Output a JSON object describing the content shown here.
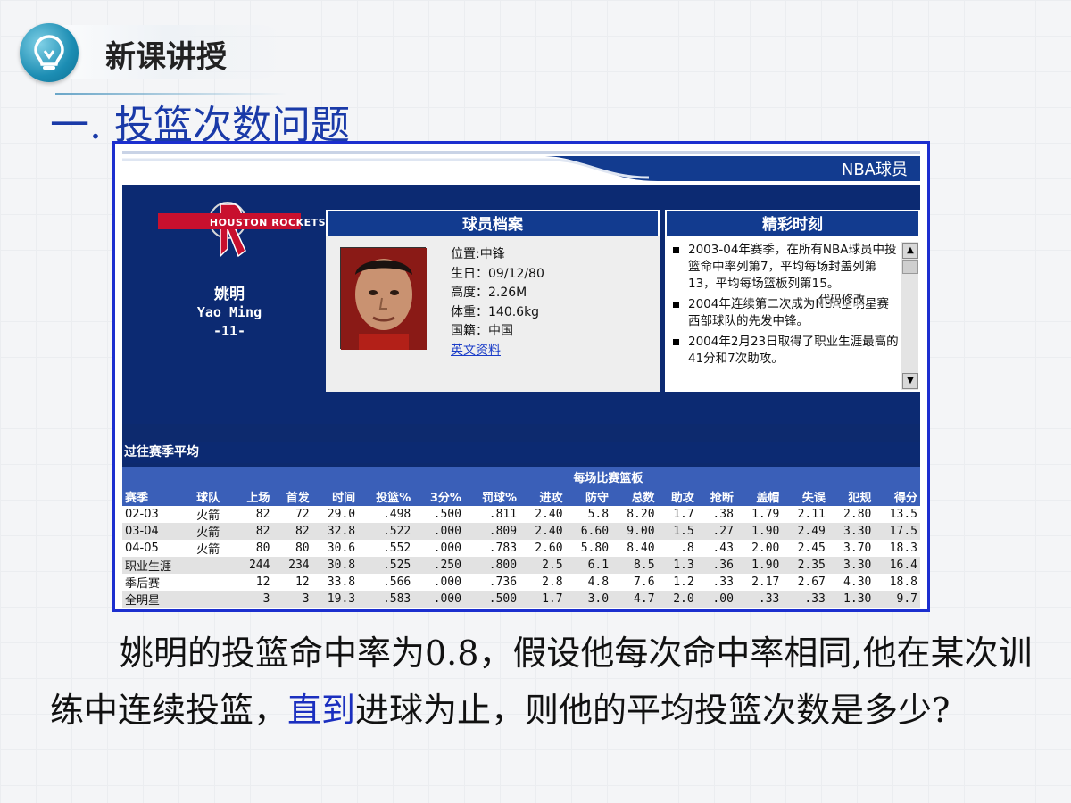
{
  "header": {
    "title": "新课讲授"
  },
  "section": {
    "title": "一. 投篮次数问题"
  },
  "nba": {
    "title": "NBA球员",
    "team": "HOUSTON ROCKETS",
    "player": {
      "name_cn": "姚明",
      "name_en": "Yao Ming",
      "number": "-11-"
    },
    "profile": {
      "heading": "球员档案",
      "position": "位置:中锋",
      "birthday": "生日：09/12/80",
      "height": "高度：2.26M",
      "weight": "体重：140.6kg",
      "nationality": "国籍：中国",
      "link": "英文资料"
    },
    "highlights": {
      "heading": "精彩时刻",
      "items": [
        "2003-04年赛季，在所有NBA球员中投篮命中率列第7，平均每场封盖列第13，平均每场篮板列第15。",
        "2004年连续第二次成为NBA全明星赛西部球队的先发中锋。",
        "2004年2月23日取得了职业生涯最高的41分和7次助攻。"
      ],
      "overlay_text": "代码修改"
    },
    "stats": {
      "heading": "过往赛季平均",
      "group_header": "每场比赛篮板",
      "columns": [
        "赛季",
        "球队",
        "上场",
        "首发",
        "时间",
        "投篮%",
        "3分%",
        "罚球%",
        "进攻",
        "防守",
        "总数",
        "助攻",
        "抢断",
        "盖帽",
        "失误",
        "犯规",
        "得分"
      ],
      "rows": [
        [
          "02-03",
          "火箭",
          "82",
          "72",
          "29.0",
          ".498",
          ".500",
          ".811",
          "2.40",
          "5.8",
          "8.20",
          "1.7",
          ".38",
          "1.79",
          "2.11",
          "2.80",
          "13.5"
        ],
        [
          "03-04",
          "火箭",
          "82",
          "82",
          "32.8",
          ".522",
          ".000",
          ".809",
          "2.40",
          "6.60",
          "9.00",
          "1.5",
          ".27",
          "1.90",
          "2.49",
          "3.30",
          "17.5"
        ],
        [
          "04-05",
          "火箭",
          "80",
          "80",
          "30.6",
          ".552",
          ".000",
          ".783",
          "2.60",
          "5.80",
          "8.40",
          ".8",
          ".43",
          "2.00",
          "2.45",
          "3.70",
          "18.3"
        ],
        [
          "职业生涯",
          "",
          "244",
          "234",
          "30.8",
          ".525",
          ".250",
          ".800",
          "2.5",
          "6.1",
          "8.5",
          "1.3",
          ".36",
          "1.90",
          "2.35",
          "3.30",
          "16.4"
        ],
        [
          "季后赛",
          "",
          "12",
          "12",
          "33.8",
          ".566",
          ".000",
          ".736",
          "2.8",
          "4.8",
          "7.6",
          "1.2",
          ".33",
          "2.17",
          "2.67",
          "4.30",
          "18.8"
        ],
        [
          "全明星",
          "",
          "3",
          "3",
          "19.3",
          ".583",
          ".000",
          ".500",
          "1.7",
          "3.0",
          "4.7",
          "2.0",
          ".00",
          ".33",
          ".33",
          "1.30",
          "9.7"
        ]
      ]
    }
  },
  "question": {
    "part1": "姚明的投篮命中率为0.8，假设他每次命中率相同,他在某次训练中连续投篮，",
    "emphasis": "直到",
    "part2": "进球为止，则他的平均投篮次数是多少?"
  },
  "colors": {
    "title_blue": "#1a3aa8",
    "panel_navy": "#0c2a72",
    "panel_border": "#1c2fcf",
    "emphasis": "#1b2fbf"
  }
}
